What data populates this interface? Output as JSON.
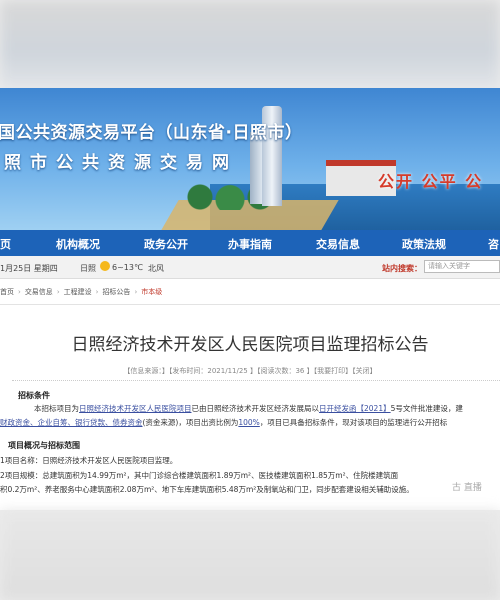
{
  "banner": {
    "title_line1": "国公共资源交易平台（山东省·日照市）",
    "title_line2": "照市公共资源交易网",
    "slogan": "公开 公平 公"
  },
  "nav": [
    "页",
    "机构概况",
    "政务公开",
    "办事指南",
    "交易信息",
    "政策法规",
    "咨"
  ],
  "infobar": {
    "date": "1月25日 星期四",
    "city": "日照",
    "temp": "6~13℃",
    "wind": "北风",
    "search_label": "站内搜索：",
    "search_placeholder": "请输入关键字"
  },
  "breadcrumb": {
    "items": [
      "首页",
      "交易信息",
      "工程建设",
      "招标公告"
    ],
    "current": "市本级"
  },
  "article": {
    "title": "日照经济技术开发区人民医院项目监理招标公告",
    "meta": "【信息来源：】【发布时间：2021/11/25 】【阅读次数：36 】【我要打印】【关闭】",
    "section1": "招标条件",
    "para1_line1_a": "本招标项目为",
    "para1_line1_b": "日照经济技术开发区人民医院项目",
    "para1_line1_c": "已由日照经济技术开发区经济发展局以",
    "para1_line1_d": "日开经发函【2021】",
    "para1_line1_e": "5号文件批准建设，建",
    "para1_line2_a": "财政资金、企业自筹、银行贷款、债券资金",
    "para1_line2_b": "(资金来源)，项目出资比例为",
    "para1_line2_c": "100%",
    "para1_line2_d": "，项目已具备招标条件，现对该项目的监理进行公开招标",
    "section2": "项目概况与招标范围",
    "item1": "1项目名称：日照经济技术开发区人民医院项目监理。",
    "item2": "2项目规模：总建筑面积为14.99万m²，其中门诊综合楼建筑面积1.89万m²、医技楼建筑面积1.85万m²、住院楼建筑面",
    "item2_cont": "积0.2万m²、养老服务中心建筑面积2.08万m²、地下车库建筑面积5.48万m²及制氧站和门卫，同步配套建设相关辅助设施。"
  },
  "watermark": "古 直播"
}
